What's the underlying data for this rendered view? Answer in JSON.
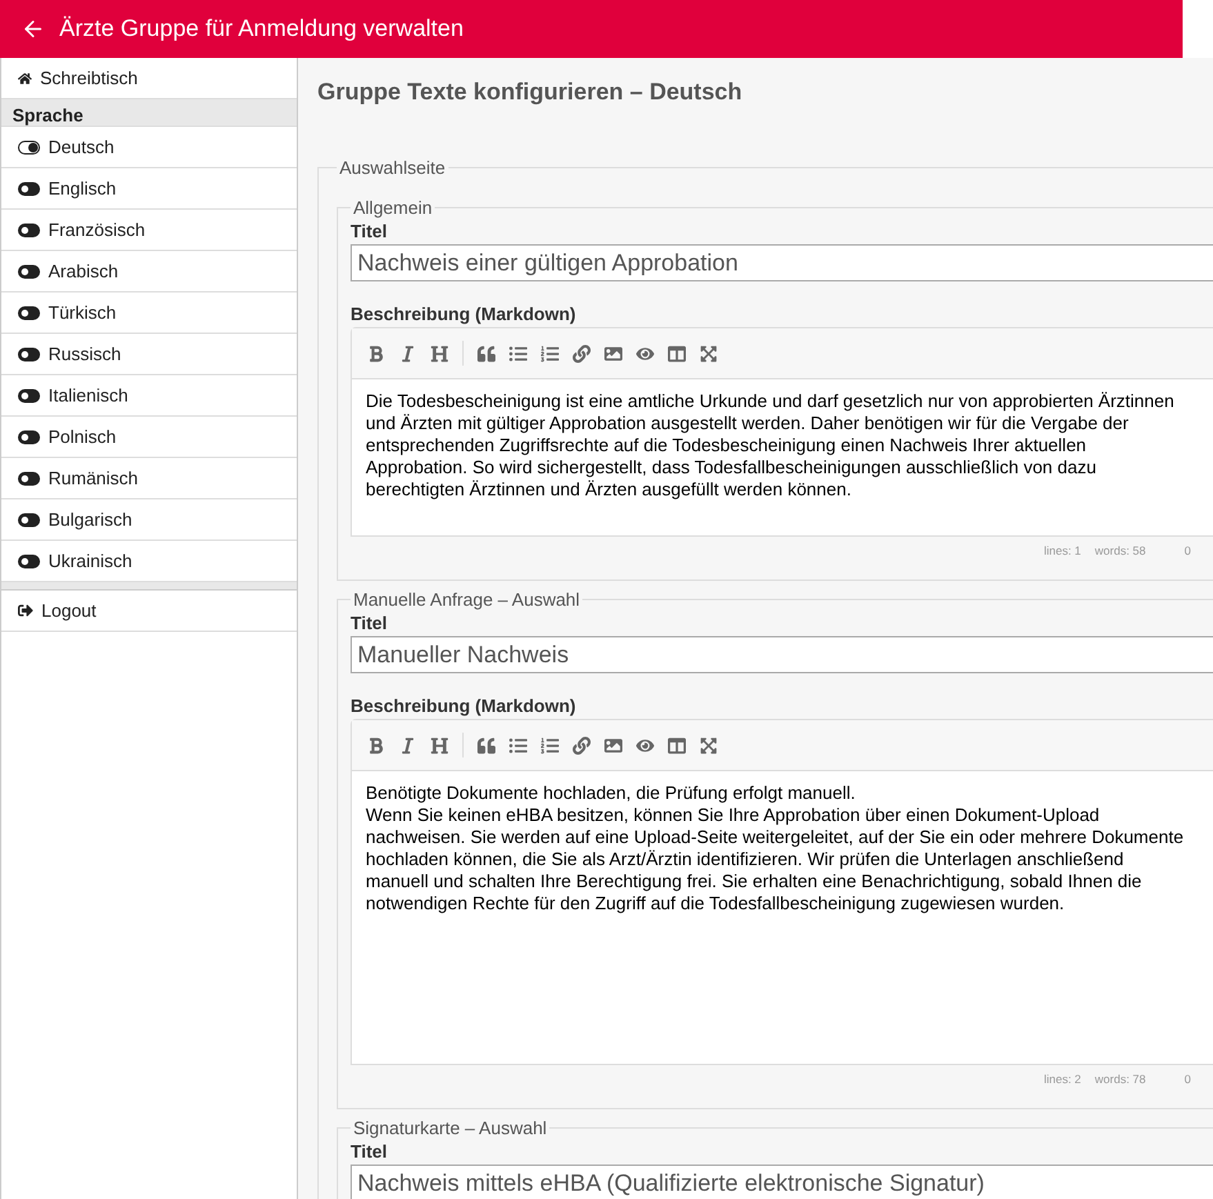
{
  "header": {
    "title": "Ärzte Gruppe für Anmeldung verwalten"
  },
  "sidebar": {
    "home": "Schreibtisch",
    "section": "Sprache",
    "languages": [
      {
        "label": "Deutsch",
        "selected": true
      },
      {
        "label": "Englisch",
        "selected": false
      },
      {
        "label": "Französisch",
        "selected": false
      },
      {
        "label": "Arabisch",
        "selected": false
      },
      {
        "label": "Türkisch",
        "selected": false
      },
      {
        "label": "Russisch",
        "selected": false
      },
      {
        "label": "Italienisch",
        "selected": false
      },
      {
        "label": "Polnisch",
        "selected": false
      },
      {
        "label": "Rumänisch",
        "selected": false
      },
      {
        "label": "Bulgarisch",
        "selected": false
      },
      {
        "label": "Ukrainisch",
        "selected": false
      }
    ],
    "logout": "Logout"
  },
  "page": {
    "title": "Gruppe Texte konfigurieren – Deutsch",
    "section": {
      "legend": "Auswahlseite",
      "groups": [
        {
          "legend": "Allgemein",
          "title_label": "Titel",
          "title_value": "Nachweis einer gültigen Approbation",
          "description": {
            "label": "Beschreibung (Markdown)",
            "lines": [
              "Die Todesbescheinigung ist eine amtliche Urkunde und darf gesetzlich nur von approbierten Ärztinnen und Ärzten mit gültiger Approbation ausgestellt werden. Daher benötigen wir für die Vergabe der entsprechenden Zugriffsrechte auf die Todesbescheinigung einen Nachweis Ihrer aktuellen Approbation. So wird sichergestellt, dass Todesfallbescheinigungen ausschließlich von dazu berechtigten Ärztinnen und Ärzten ausgefüllt werden können."
            ],
            "lines_count": "lines: 1",
            "words_count": "words: 58",
            "cursor": "0"
          }
        },
        {
          "legend": "Manuelle Anfrage – Auswahl",
          "title_label": "Titel",
          "title_value": "Manueller Nachweis",
          "description": {
            "label": "Beschreibung (Markdown)",
            "lines": [
              "Benötigte Dokumente hochladen, die Prüfung erfolgt manuell.",
              "Wenn Sie keinen eHBA besitzen, können Sie Ihre Approbation über einen Dokument-Upload nachweisen. Sie werden auf eine Upload-Seite weitergeleitet, auf der Sie ein oder mehrere Dokumente hochladen können, die Sie als Arzt/Ärztin identifizieren. Wir prüfen die Unterlagen anschließend manuell und schalten Ihre Berechtigung frei. Sie erhalten eine Benachrichtigung, sobald Ihnen die notwendigen Rechte für den Zugriff auf die Todesfallbescheinigung zugewiesen wurden."
            ],
            "lines_count": "lines: 2",
            "words_count": "words: 78",
            "cursor": "0"
          }
        },
        {
          "legend": "Signaturkarte – Auswahl",
          "title_label": "Titel",
          "title_value": "Nachweis mittels eHBA (Qualifizierte elektronische Signatur)"
        }
      ]
    }
  }
}
